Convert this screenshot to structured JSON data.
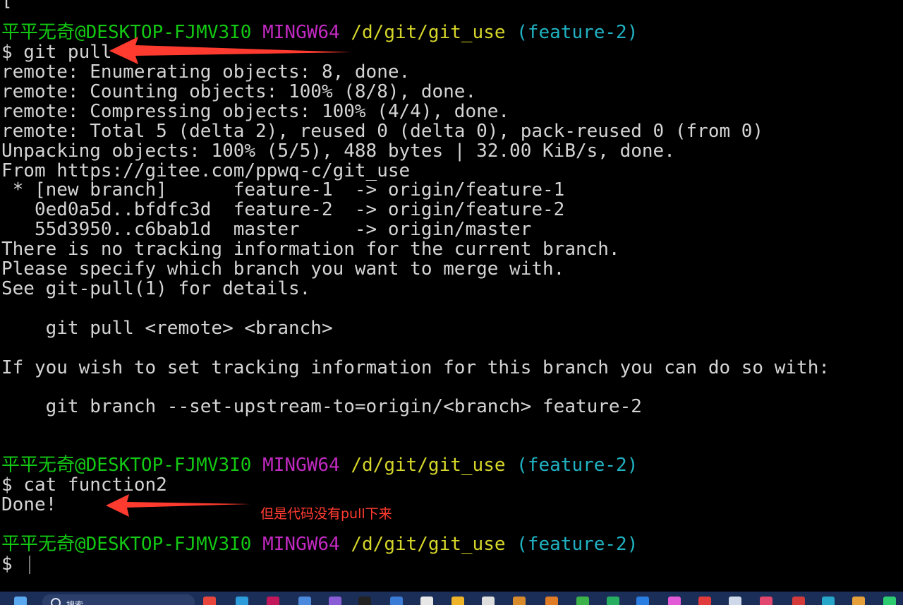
{
  "terminal": {
    "top_fragment": "[",
    "prompts": [
      {
        "user": "平平无奇@DESKTOP-FJMV3I0",
        "shell": "MINGW64",
        "path": "/d/git/git_use",
        "branch": "(feature-2)"
      },
      {
        "user": "平平无奇@DESKTOP-FJMV3I0",
        "shell": "MINGW64",
        "path": "/d/git/git_use",
        "branch": "(feature-2)"
      },
      {
        "user": "平平无奇@DESKTOP-FJMV3I0",
        "shell": "MINGW64",
        "path": "/d/git/git_use",
        "branch": "(feature-2)"
      }
    ],
    "cmd1": "$ git pull",
    "output1": [
      "remote: Enumerating objects: 8, done.",
      "remote: Counting objects: 100% (8/8), done.",
      "remote: Compressing objects: 100% (4/4), done.",
      "remote: Total 5 (delta 2), reused 0 (delta 0), pack-reused 0 (from 0)",
      "Unpacking objects: 100% (5/5), 488 bytes | 32.00 KiB/s, done.",
      "From https://gitee.com/ppwq-c/git_use",
      " * [new branch]      feature-1  -> origin/feature-1",
      "   0ed0a5d..bfdfc3d  feature-2  -> origin/feature-2",
      "   55d3950..c6bab1d  master     -> origin/master",
      "There is no tracking information for the current branch.",
      "Please specify which branch you want to merge with.",
      "See git-pull(1) for details.",
      "",
      "    git pull <remote> <branch>",
      "",
      "If you wish to set tracking information for this branch you can do so with:",
      "",
      "    git branch --set-upstream-to=origin/<branch> feature-2"
    ],
    "cmd2": "$ cat function2",
    "output2": "Done!",
    "cmd3": "$ "
  },
  "annotation": {
    "text": "但是代码没有pull下来",
    "color": "#ff3b30"
  },
  "taskbar": {
    "search_placeholder": "搜索"
  }
}
